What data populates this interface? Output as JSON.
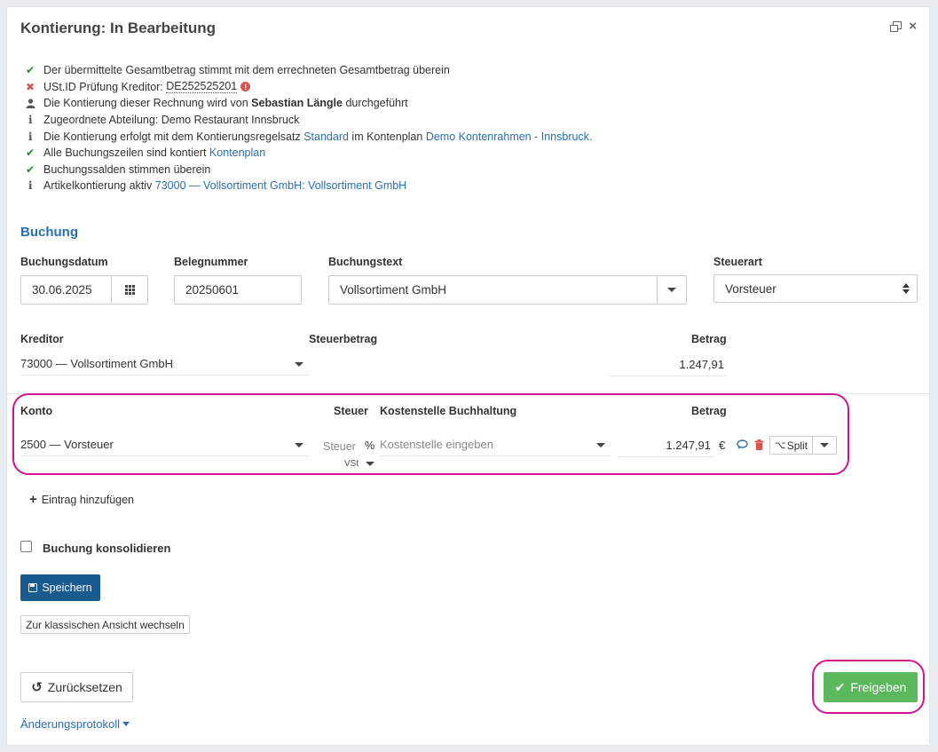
{
  "header": {
    "title": "Kontierung: In Bearbeitung",
    "restore_icon": "window-restore-icon",
    "close_icon": "close-icon"
  },
  "status": {
    "row1": {
      "icon": "check",
      "text": "Der übermittelte Gesamtbetrag stimmt mit dem errechneten Gesamtbetrag überein"
    },
    "row2": {
      "icon": "cross",
      "prefix": "USt.ID Prüfung Kreditor: ",
      "vat": "DE252525201"
    },
    "row3": {
      "icon": "user",
      "prefix": "Die Kontierung dieser Rechnung wird von ",
      "name": "Sebastian Längle",
      "suffix": " durchgeführt"
    },
    "row4": {
      "icon": "info",
      "text": "Zugeordnete Abteilung: Demo Restaurant Innsbruck"
    },
    "row5": {
      "icon": "info",
      "prefix": "Die Kontierung erfolgt mit dem Kontierungsregelsatz ",
      "link1": "Standard",
      "middle": " im Kontenplan ",
      "link2": "Demo Kontenrahmen - Innsbruck",
      "suffix": "."
    },
    "row6": {
      "icon": "check",
      "prefix": "Alle Buchungszeilen sind kontiert ",
      "link": "Kontenplan"
    },
    "row7": {
      "icon": "check",
      "text": "Buchungssalden stimmen überein"
    },
    "row8": {
      "icon": "info",
      "prefix": "Artikelkontierung aktiv ",
      "link": "73000 — Vollsortiment GmbH: Vollsortiment GmbH"
    }
  },
  "booking": {
    "section_title": "Buchung",
    "date_label": "Buchungsdatum",
    "date_value": "30.06.2025",
    "receipt_label": "Belegnummer",
    "receipt_value": "20250601",
    "text_label": "Buchungstext",
    "text_value": "Vollsortiment GmbH",
    "tax_type_label": "Steuerart",
    "tax_type_value": "Vorsteuer",
    "creditor_label": "Kreditor",
    "creditor_value": "73000 — Vollsortiment GmbH",
    "tax_amount_label": "Steuerbetrag",
    "amount_label": "Betrag",
    "amount_value": "1.247,91"
  },
  "lines": {
    "headers": {
      "account": "Konto",
      "tax": "Steuer",
      "cost_center": "Kostenstelle Buchhaltung",
      "amount": "Betrag"
    },
    "row": {
      "account": "2500 — Vorsteuer",
      "tax_placeholder": "Steuer",
      "percent": "%",
      "tax_code": "VSt",
      "cost_center_placeholder": "Kostenstelle eingeben",
      "amount": "1.247,91",
      "currency": "€",
      "split_label": "Split"
    }
  },
  "actions": {
    "add_entry": "Eintrag hinzufügen",
    "consolidate": "Buchung konsolidieren",
    "save": "Speichern",
    "classic_view": "Zur klassischen Ansicht wechseln",
    "reset": "Zurücksetzen",
    "approve": "Freigeben",
    "history": "Änderungsprotokoll"
  },
  "colors": {
    "link": "#2a6fb0",
    "success": "#5cb85c",
    "primary": "#1a5b8f",
    "highlight": "#d4148f",
    "error": "#d9534f"
  }
}
